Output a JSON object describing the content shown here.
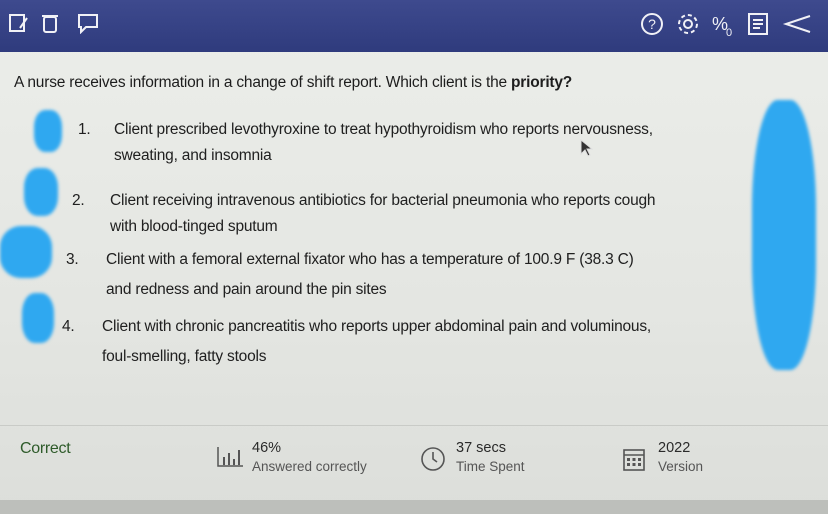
{
  "toolbar": {
    "left_icons": [
      "notes-icon",
      "trash-icon",
      "comment-icon"
    ],
    "right_icons": [
      "help-icon",
      "settings-icon",
      "calculator-icon",
      "lab-values-icon",
      "flag-icon"
    ]
  },
  "question": {
    "stem": "A nurse receives information in a change of shift report.  Which client is the ",
    "stem_emphasis": "priority?"
  },
  "options": [
    {
      "number": "1.",
      "line1": "Client prescribed levothyroxine to treat hypothyroidism who reports nervousness,",
      "line2": "sweating, and insomnia"
    },
    {
      "number": "2.",
      "line1": "Client receiving intravenous antibiotics for bacterial pneumonia who reports cough",
      "line2": "with blood-tinged sputum"
    },
    {
      "number": "3.",
      "line1": "Client with a femoral external fixator who has a temperature of 100.9 F (38.3 C)",
      "line2": "and redness and pain around the pin sites"
    },
    {
      "number": "4.",
      "line1": "Client with chronic pancreatitis who reports upper abdominal pain and voluminous,",
      "line2": "foul-smelling, fatty stools"
    }
  ],
  "footer": {
    "result": "Correct",
    "stats": [
      {
        "icon": "bar-chart-icon",
        "value": "46%",
        "label": "Answered correctly"
      },
      {
        "icon": "clock-icon",
        "value": "37 secs",
        "label": "Time Spent"
      },
      {
        "icon": "calendar-icon",
        "value": "2022",
        "label": "Version"
      }
    ]
  },
  "colors": {
    "toolbar_bg": "#2f3b7d",
    "page_bg": "#e6e8e4",
    "correct_text": "#2e5b2a",
    "redaction": "#2fa8f0"
  }
}
